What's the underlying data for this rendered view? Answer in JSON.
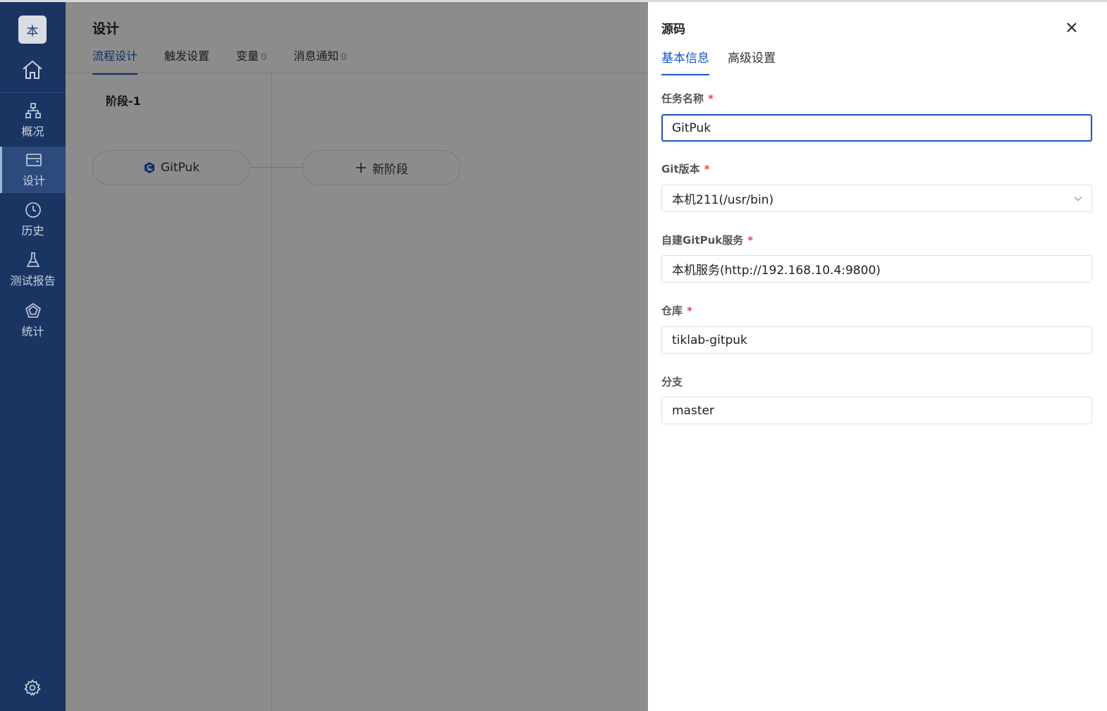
{
  "sidebar": {
    "avatar_text": "本",
    "items": [
      {
        "label": "概况",
        "icon": "sitemap-icon"
      },
      {
        "label": "设计",
        "icon": "design-icon",
        "active": true
      },
      {
        "label": "历史",
        "icon": "clock-icon"
      },
      {
        "label": "测试报告",
        "icon": "flask-icon"
      },
      {
        "label": "统计",
        "icon": "pentagon-chart-icon"
      }
    ]
  },
  "main": {
    "title": "设计",
    "tabs": [
      {
        "label": "流程设计",
        "count": ""
      },
      {
        "label": "触发设置",
        "count": ""
      },
      {
        "label": "变量",
        "count": "0"
      },
      {
        "label": "消息通知",
        "count": "0"
      }
    ],
    "stage_title": "阶段-1",
    "task_label": "GitPuk",
    "new_stage_label": "新阶段"
  },
  "drawer": {
    "title": "源码",
    "tabs": [
      "基本信息",
      "高级设置"
    ],
    "fields": [
      {
        "label": "任务名称",
        "required": true,
        "value": "GitPuk"
      },
      {
        "label": "Git版本",
        "required": true,
        "value": "本机211(/usr/bin)"
      },
      {
        "label": "自建GitPuk服务",
        "required": true,
        "value": "本机服务(http://192.168.10.4:9800)"
      },
      {
        "label": "仓库",
        "required": true,
        "value": "tiklab-gitpuk"
      },
      {
        "label": "分支",
        "required": false,
        "value": "master"
      }
    ],
    "required_mark": "*"
  },
  "colors": {
    "sidebar_bg": "#1b3563",
    "accent": "#1a56c0",
    "required": "#e5484d"
  }
}
